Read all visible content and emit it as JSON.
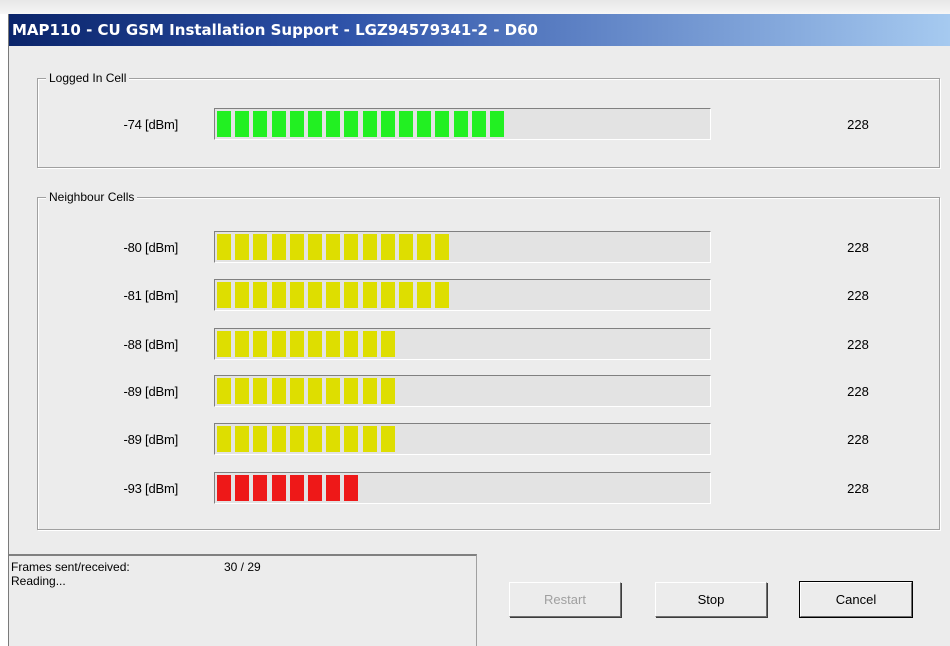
{
  "window": {
    "title": "MAP110 - CU GSM Installation Support - LGZ94579341-2 - D60"
  },
  "colors": {
    "strong": "#22f022",
    "medium": "#dede00",
    "weak": "#ee1818"
  },
  "logged_in_cell": {
    "label": "Logged In Cell",
    "row": {
      "dbm": "-74 [dBm]",
      "value": "228",
      "segments": 16,
      "level": "strong"
    }
  },
  "neighbour_cells": {
    "label": "Neighbour Cells",
    "rows": [
      {
        "dbm": "-80 [dBm]",
        "value": "228",
        "segments": 13,
        "level": "medium"
      },
      {
        "dbm": "-81 [dBm]",
        "value": "228",
        "segments": 13,
        "level": "medium"
      },
      {
        "dbm": "-88 [dBm]",
        "value": "228",
        "segments": 10,
        "level": "medium"
      },
      {
        "dbm": "-89 [dBm]",
        "value": "228",
        "segments": 10,
        "level": "medium"
      },
      {
        "dbm": "-89 [dBm]",
        "value": "228",
        "segments": 10,
        "level": "medium"
      },
      {
        "dbm": "-93 [dBm]",
        "value": "228",
        "segments": 8,
        "level": "weak"
      }
    ]
  },
  "status": {
    "frames_label": "Frames sent/received:",
    "frames_value": "30 / 29",
    "state": "Reading..."
  },
  "buttons": {
    "restart": "Restart",
    "stop": "Stop",
    "cancel": "Cancel"
  }
}
